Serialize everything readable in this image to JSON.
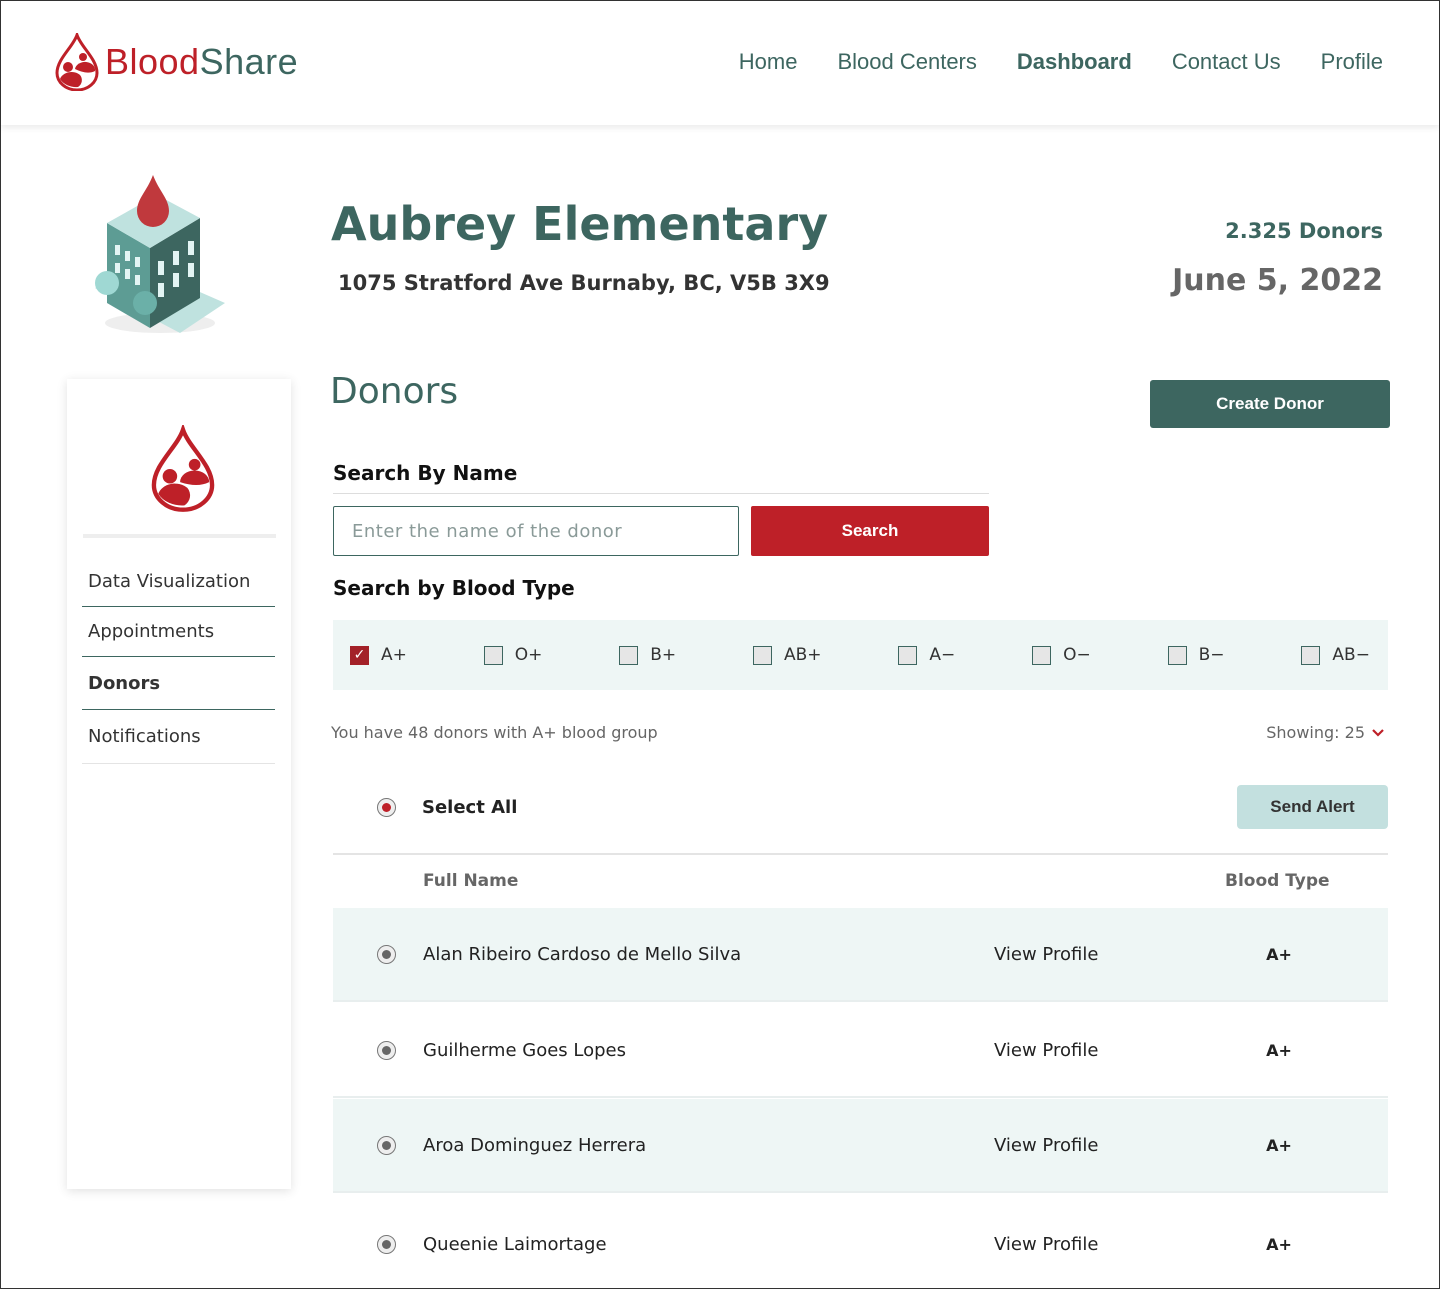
{
  "header": {
    "logo_part1": "Blood",
    "logo_part2": "Share",
    "nav": [
      {
        "label": "Home",
        "active": false
      },
      {
        "label": "Blood Centers",
        "active": false
      },
      {
        "label": "Dashboard",
        "active": true
      },
      {
        "label": "Contact Us",
        "active": false
      },
      {
        "label": "Profile",
        "active": false
      }
    ]
  },
  "center": {
    "name": "Aubrey Elementary",
    "address": "1075 Stratford Ave Burnaby, BC, V5B 3X9",
    "donor_count": "2.325 Donors",
    "date": "June 5, 2022"
  },
  "sidebar": {
    "items": [
      {
        "label": "Data Visualization",
        "active": false
      },
      {
        "label": "Appointments",
        "active": false
      },
      {
        "label": "Donors",
        "active": true
      },
      {
        "label": "Notifications",
        "active": false
      }
    ]
  },
  "donors": {
    "heading": "Donors",
    "create_label": "Create Donor",
    "search_heading": "Search By Name",
    "search_placeholder": "Enter the name of the donor",
    "search_value": "",
    "search_label": "Search",
    "blood_heading": "Search by Blood Type",
    "blood_types": [
      {
        "label": "A+",
        "checked": true
      },
      {
        "label": "O+",
        "checked": false
      },
      {
        "label": "B+",
        "checked": false
      },
      {
        "label": "AB+",
        "checked": false
      },
      {
        "label": "A−",
        "checked": false
      },
      {
        "label": "O−",
        "checked": false
      },
      {
        "label": "B−",
        "checked": false
      },
      {
        "label": "AB−",
        "checked": false
      }
    ],
    "info": "You have 48 donors with A+ blood group",
    "showing": "Showing: 25",
    "select_all": "Select All",
    "send_alert": "Send Alert",
    "col_name": "Full Name",
    "col_type": "Blood Type",
    "rows": [
      {
        "name": "Alan Ribeiro Cardoso de Mello Silva",
        "link": "View Profile",
        "type": "A+"
      },
      {
        "name": "Guilherme Goes Lopes",
        "link": "View Profile",
        "type": "A+"
      },
      {
        "name": "Aroa Dominguez Herrera",
        "link": "View Profile",
        "type": "A+"
      },
      {
        "name": "Queenie Laimortage",
        "link": "View Profile",
        "type": "A+"
      }
    ]
  },
  "colors": {
    "brand_red": "#be2028",
    "brand_teal": "#3d6660",
    "light_bg": "#eef6f5",
    "alert_bg": "#c3e0df"
  }
}
